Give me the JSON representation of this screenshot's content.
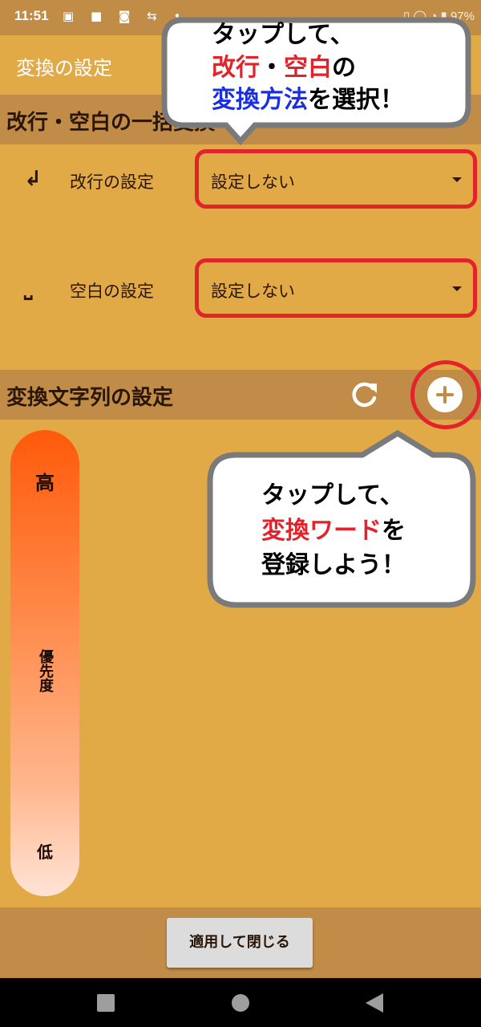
{
  "status_bar": {
    "time": "11:51",
    "icons": "▣ ■ ◙ ⇆ •",
    "right": "▯ ◯ ◔ ▮ 97%"
  },
  "app_bar": {
    "title": "変換の設定"
  },
  "section_linebreak": {
    "title": "改行・空白の一括変換",
    "rows": [
      {
        "icon": "↲",
        "label": "改行の設定",
        "value": "設定しない"
      },
      {
        "icon": "⎵",
        "label": "空白の設定",
        "value": "設定しない"
      }
    ]
  },
  "section_strings": {
    "title": "変換文字列の設定"
  },
  "priority": {
    "high": "高",
    "mid": "優先度",
    "low": "低"
  },
  "footer": {
    "apply_label": "適用して閉じる"
  },
  "callout_top": {
    "line1": "タップして、",
    "line2_a": "改行",
    "line2_b": "・",
    "line2_c": "空白",
    "line2_d": "の",
    "line3_a": "変換方法",
    "line3_b": "を選択！"
  },
  "callout_bottom": {
    "line1": "タップして、",
    "line2_a": "変換ワード",
    "line2_b": "を",
    "line3": "登録しよう！"
  },
  "colors": {
    "accent": "#e2aa46",
    "header": "#c18c48",
    "highlight": "#e2232b",
    "emphasis_blue": "#1a2fe0"
  }
}
